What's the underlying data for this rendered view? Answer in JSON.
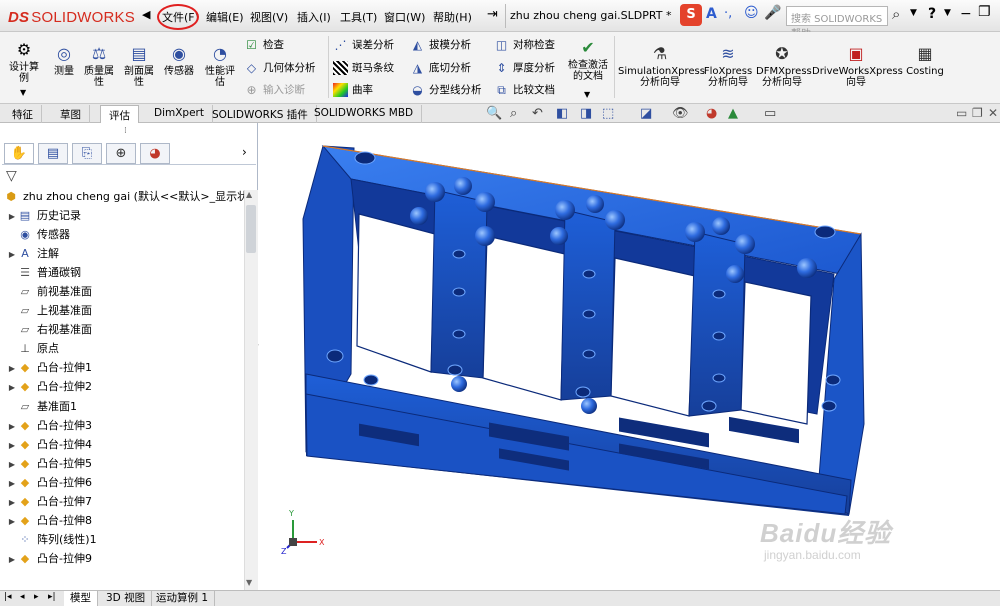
{
  "app": {
    "logo_ds": "DS",
    "logo_text": "SOLIDWORKS",
    "menus": [
      "文件(F)",
      "编辑(E)",
      "视图(V)",
      "插入(I)",
      "工具(T)",
      "窗口(W)",
      "帮助(H)"
    ],
    "doc_title": "zhu zhou cheng gai.SLDPRT *",
    "search_placeholder": "搜索 SOLIDWORKS 帮助",
    "help_label": "?"
  },
  "ribbon": {
    "large": [
      {
        "label": "设计算\n例",
        "icon": "design-study-icon"
      },
      {
        "label": "测量",
        "icon": "measure-icon"
      },
      {
        "label": "质量属\n性",
        "icon": "mass-properties-icon"
      },
      {
        "label": "剖面属\n性",
        "icon": "section-properties-icon"
      },
      {
        "label": "传感器",
        "icon": "sensor-icon"
      },
      {
        "label": "性能评\n估",
        "icon": "performance-evaluation-icon"
      }
    ],
    "small_col1": [
      "检查",
      "几何体分析",
      "输入诊断"
    ],
    "small_col2": [
      "误差分析",
      "斑马条纹",
      "曲率"
    ],
    "small_col3": [
      "拔模分析",
      "底切分析",
      "分型线分析"
    ],
    "small_col4": [
      "对称检查",
      "厚度分析",
      "比较文档"
    ],
    "check_active_doc": "检查激活\n的文档",
    "xpress": [
      {
        "label": "SimulationXpress\n分析向导"
      },
      {
        "label": "FloXpress\n分析向导"
      },
      {
        "label": "DFMXpress\n分析向导"
      },
      {
        "label": "DriveWorksXpress\n向导"
      },
      {
        "label": "Costing"
      }
    ]
  },
  "command_tabs": [
    "特征",
    "草图",
    "评估",
    "DimXpert",
    "SOLIDWORKS 插件",
    "SOLIDWORKS MBD"
  ],
  "active_command_tab": "评估",
  "feature_tree": {
    "root": "zhu zhou cheng gai  (默认<<默认>_显示状态",
    "items": [
      {
        "label": "历史记录",
        "icon": "history-icon",
        "expand": true
      },
      {
        "label": "传感器",
        "icon": "sensor-icon",
        "expand": false
      },
      {
        "label": "注解",
        "icon": "annotation-icon",
        "expand": true
      },
      {
        "label": "普通碳钢",
        "icon": "material-icon",
        "expand": false
      },
      {
        "label": "前视基准面",
        "icon": "plane-icon",
        "expand": false
      },
      {
        "label": "上视基准面",
        "icon": "plane-icon",
        "expand": false
      },
      {
        "label": "右视基准面",
        "icon": "plane-icon",
        "expand": false
      },
      {
        "label": "原点",
        "icon": "origin-icon",
        "expand": false
      },
      {
        "label": "凸台-拉伸1",
        "icon": "extrude-icon",
        "expand": true
      },
      {
        "label": "凸台-拉伸2",
        "icon": "extrude-icon",
        "expand": true
      },
      {
        "label": "基准面1",
        "icon": "plane-icon",
        "expand": false
      },
      {
        "label": "凸台-拉伸3",
        "icon": "extrude-icon",
        "expand": true
      },
      {
        "label": "凸台-拉伸4",
        "icon": "extrude-icon",
        "expand": true
      },
      {
        "label": "凸台-拉伸5",
        "icon": "extrude-icon",
        "expand": true
      },
      {
        "label": "凸台-拉伸6",
        "icon": "extrude-icon",
        "expand": true
      },
      {
        "label": "凸台-拉伸7",
        "icon": "extrude-icon",
        "expand": true
      },
      {
        "label": "凸台-拉伸8",
        "icon": "extrude-icon",
        "expand": true
      },
      {
        "label": "阵列(线性)1",
        "icon": "pattern-icon",
        "expand": false
      },
      {
        "label": "凸台-拉伸9",
        "icon": "extrude-icon",
        "expand": true
      }
    ]
  },
  "bottom_tabs": [
    "模型",
    "3D 视图",
    "运动算例 1"
  ],
  "active_bottom_tab": "模型",
  "triad": {
    "x": "X",
    "y": "Y",
    "z": "Z"
  },
  "watermark": {
    "main": "Baidu经验",
    "sub": "jingyan.baidu.com"
  },
  "colors": {
    "part_blue": "#1f5fd6",
    "part_edge": "#0b2a7a",
    "highlight_red": "#e02020",
    "brand_red": "#d52b1e"
  }
}
